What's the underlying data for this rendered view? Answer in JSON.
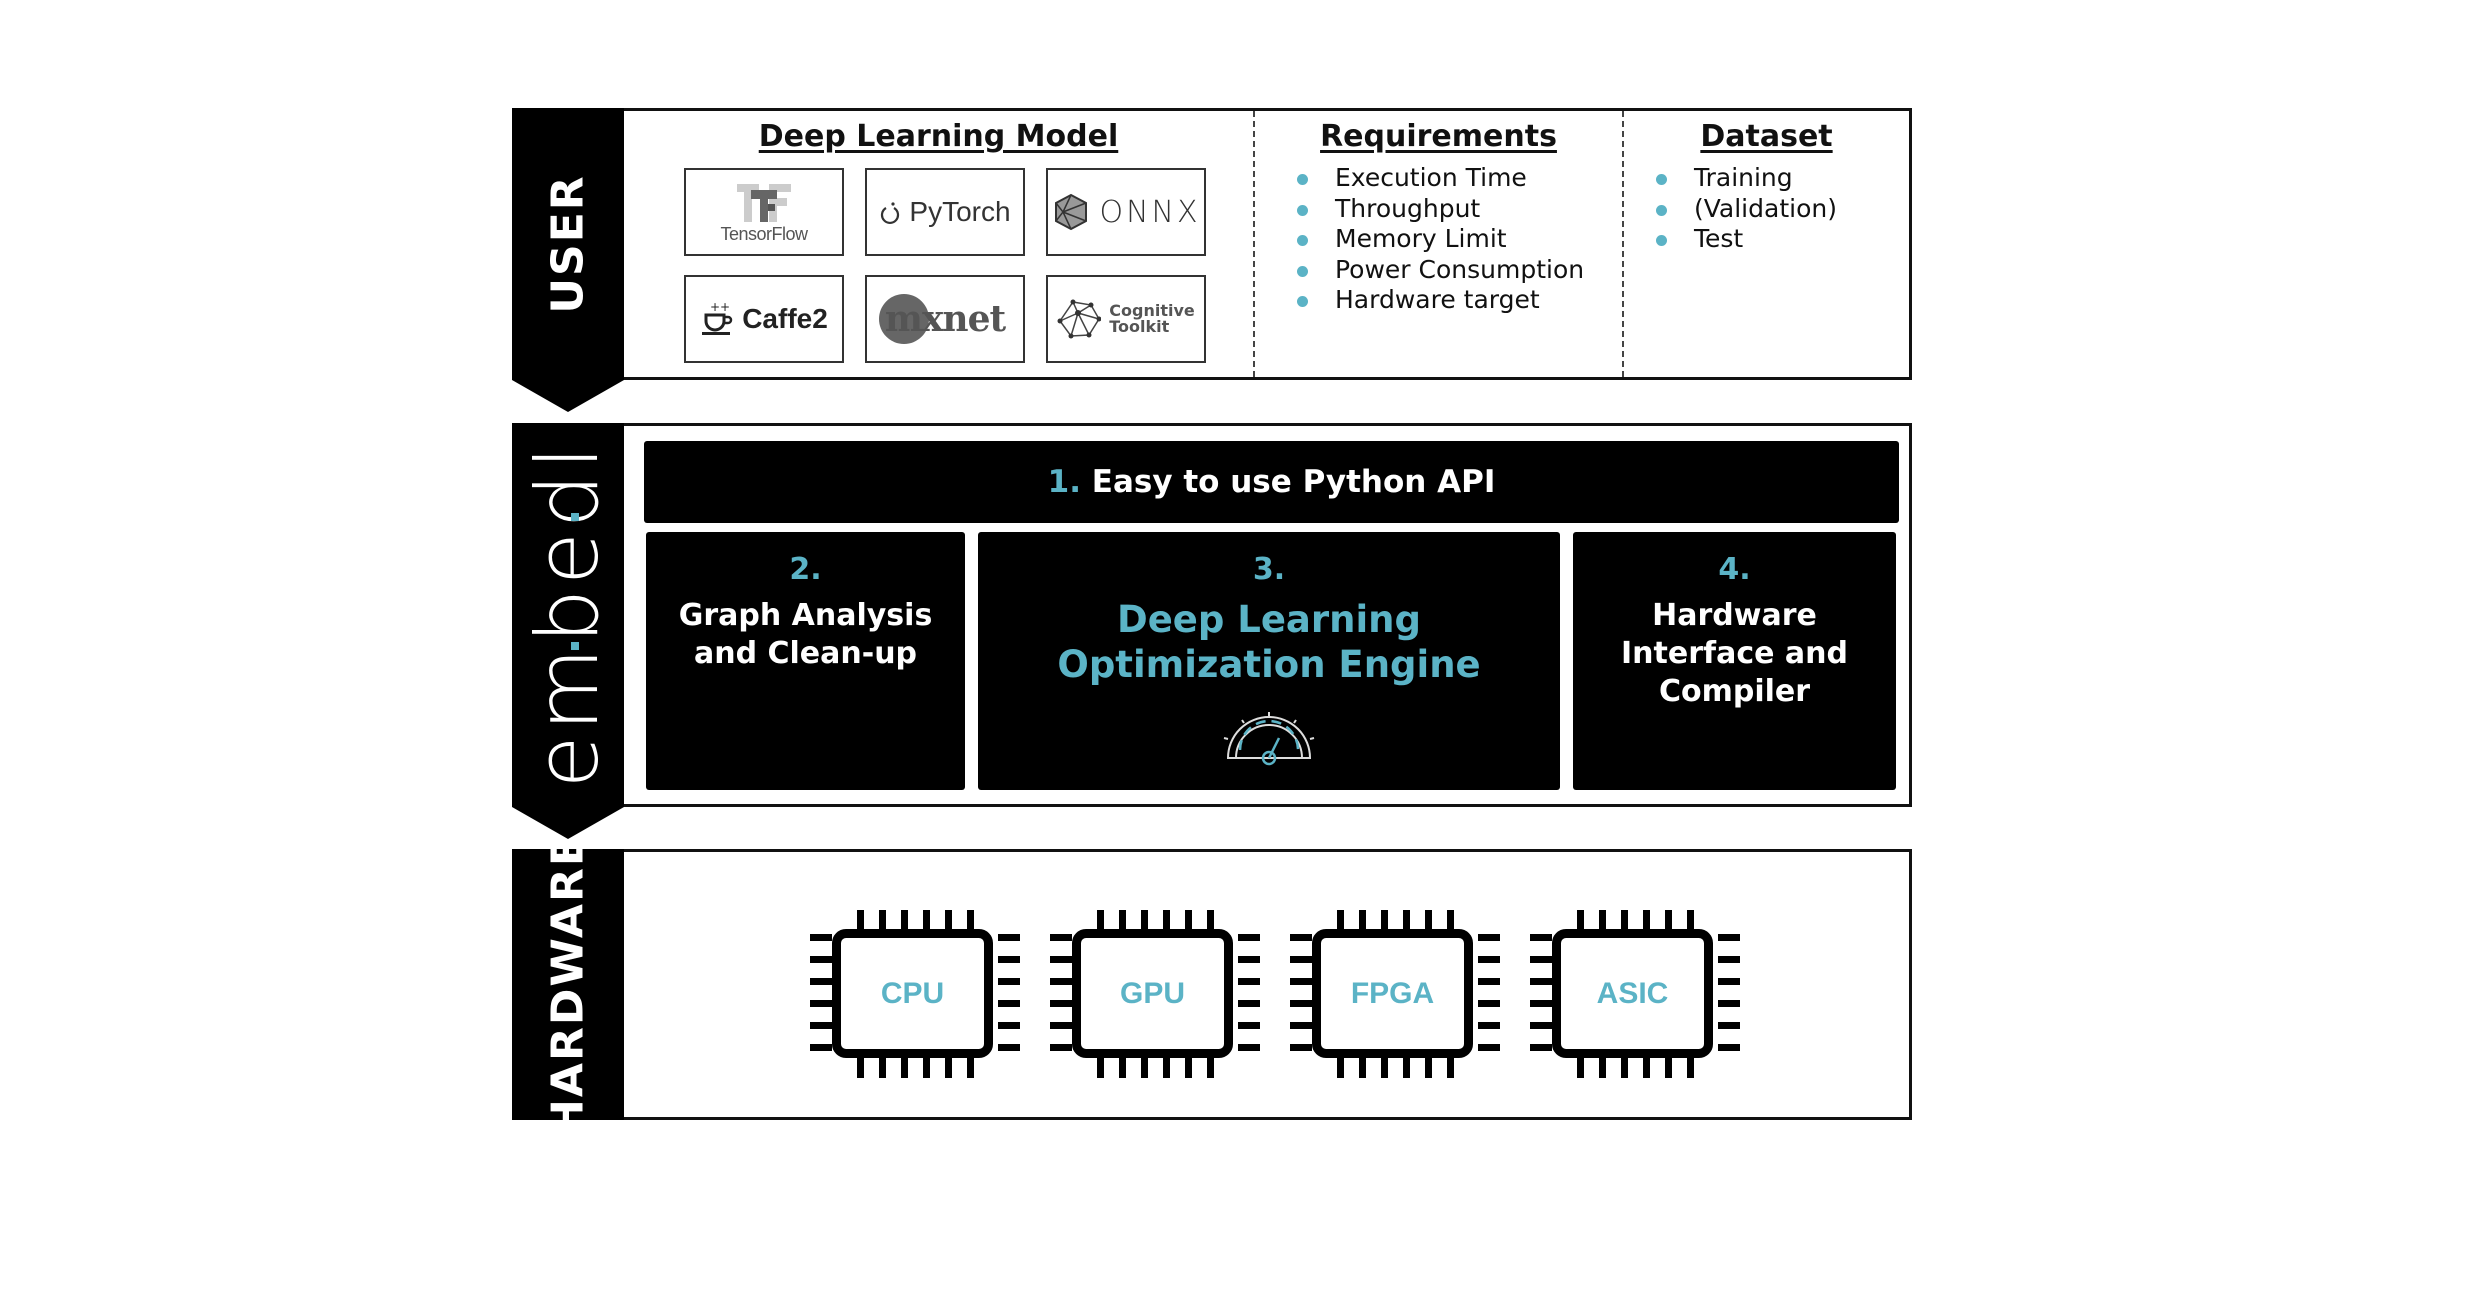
{
  "colors": {
    "accent": "#5bb3c6",
    "banner_bg": "#000000",
    "frame_border": "#111111"
  },
  "user": {
    "banner_label": "USER",
    "model": {
      "title": "Deep Learning Model",
      "frameworks": [
        {
          "name": "TensorFlow",
          "icon": "tensorflow-logo-icon"
        },
        {
          "name": "PyTorch",
          "icon": "pytorch-logo-icon"
        },
        {
          "name": "ONNX",
          "icon": "onnx-logo-icon"
        },
        {
          "name": "Caffe2",
          "icon": "caffe2-logo-icon"
        },
        {
          "name": "mxnet",
          "icon": "mxnet-logo-icon"
        },
        {
          "name": "Cognitive Toolkit",
          "name_line1": "Cognitive",
          "name_line2": "Toolkit",
          "icon": "cognitive-toolkit-logo-icon"
        }
      ]
    },
    "requirements": {
      "title": "Requirements",
      "items": [
        "Execution Time",
        "Throughput",
        "Memory Limit",
        "Power Consumption",
        "Hardware target"
      ]
    },
    "dataset": {
      "title": "Dataset",
      "items": [
        "Training",
        "(Validation)",
        "Test"
      ]
    }
  },
  "embed": {
    "banner_label": "embedl",
    "api": {
      "number": "1.",
      "label": "Easy to use Python API"
    },
    "steps": [
      {
        "number": "2.",
        "line1": "Graph Analysis",
        "line2": "and Clean-up"
      },
      {
        "number": "3.",
        "line1": "Deep Learning",
        "line2": "Optimization Engine",
        "icon": "speedometer-icon"
      },
      {
        "number": "4.",
        "line1": "Hardware",
        "line2": "Interface and",
        "line3": "Compiler"
      }
    ]
  },
  "hardware": {
    "banner_label": "HARDWARE",
    "chips": [
      "CPU",
      "GPU",
      "FPGA",
      "ASIC"
    ]
  }
}
